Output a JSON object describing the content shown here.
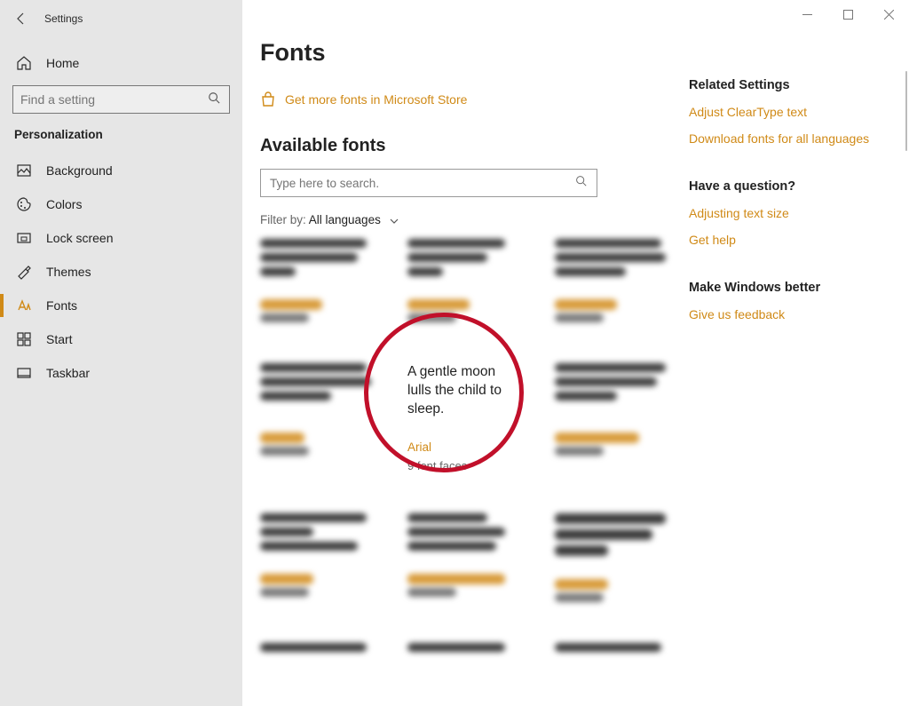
{
  "window": {
    "title": "Settings"
  },
  "sidebar": {
    "home": "Home",
    "search_placeholder": "Find a setting",
    "section": "Personalization",
    "items": [
      {
        "label": "Background"
      },
      {
        "label": "Colors"
      },
      {
        "label": "Lock screen"
      },
      {
        "label": "Themes"
      },
      {
        "label": "Fonts"
      },
      {
        "label": "Start"
      },
      {
        "label": "Taskbar"
      }
    ]
  },
  "page": {
    "title": "Fonts",
    "store_link": "Get more fonts in Microsoft Store",
    "available_heading": "Available fonts",
    "font_search_placeholder": "Type here to search.",
    "filter_label": "Filter by: ",
    "filter_value": "All languages"
  },
  "highlighted_font": {
    "preview": "A gentle moon lulls the child to sleep.",
    "name": "Arial",
    "faces": "9 font faces"
  },
  "rail": {
    "related_heading": "Related Settings",
    "related_links": [
      "Adjust ClearType text",
      "Download fonts for all languages"
    ],
    "question_heading": "Have a question?",
    "question_links": [
      "Adjusting text size",
      "Get help"
    ],
    "better_heading": "Make Windows better",
    "better_links": [
      "Give us feedback"
    ]
  }
}
